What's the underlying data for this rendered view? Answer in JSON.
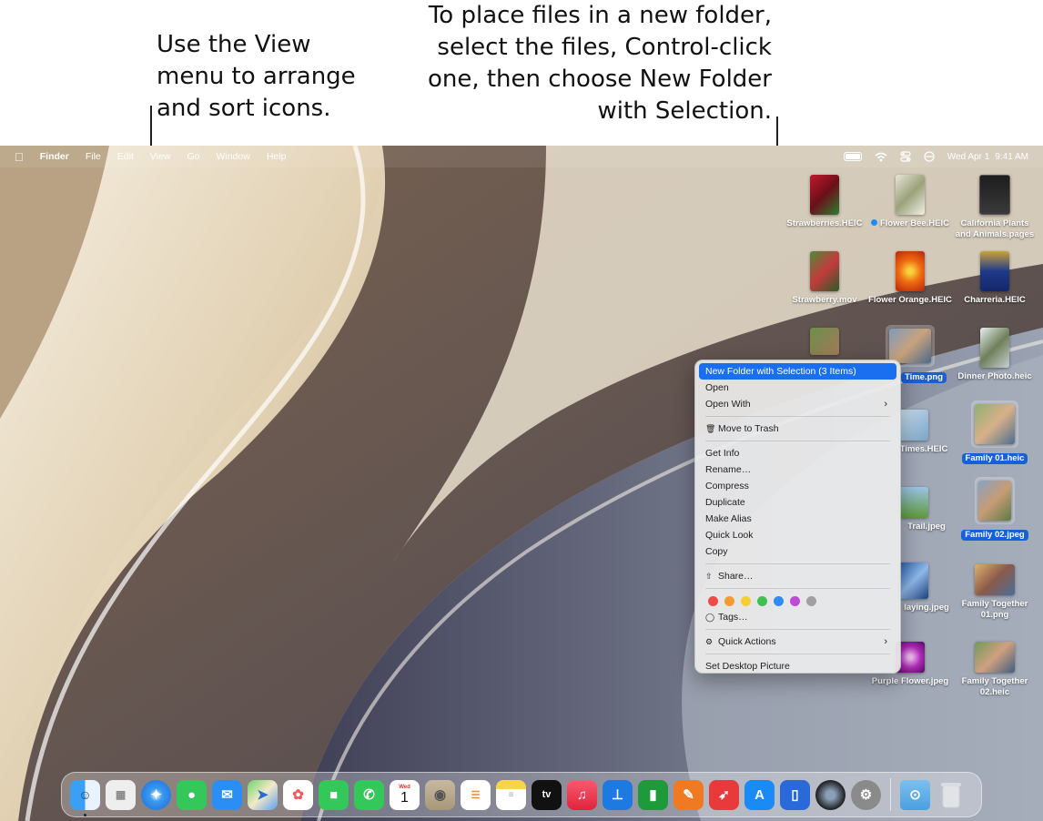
{
  "callouts": {
    "left": "Use the View menu to arrange and sort icons.",
    "right": "To place files in a new folder, select the files, Control-click one, then choose New Folder with Selection."
  },
  "menubar": {
    "apple": "",
    "app_name": "Finder",
    "items": [
      "File",
      "Edit",
      "View",
      "Go",
      "Window",
      "Help"
    ],
    "date": "Wed Apr 1",
    "time": "9:41 AM"
  },
  "desktop_icons": [
    {
      "label": "Strawberries.HEIC",
      "selected": false
    },
    {
      "label": "Flower Bee.HEIC",
      "selected": false,
      "tag": "blue"
    },
    {
      "label": "California Plants and Animals.pages",
      "selected": false
    },
    {
      "label": "Strawberry.mov",
      "selected": false
    },
    {
      "label": "Flower Orange.HEIC",
      "selected": false
    },
    {
      "label": "Charreria.HEIC",
      "selected": false
    },
    {
      "label": "Time.png",
      "selected": true
    },
    {
      "label": "Dinner Photo.heic",
      "selected": false
    },
    {
      "label": "Times.HEIC",
      "selected": false
    },
    {
      "label": "Family 01.heic",
      "selected": true
    },
    {
      "label": "Trail.jpeg",
      "selected": false
    },
    {
      "label": "Family 02.jpeg",
      "selected": true
    },
    {
      "label": "laying.jpeg",
      "selected": false
    },
    {
      "label": "Family Together 01.png",
      "selected": false
    },
    {
      "label": "Purple Flower.jpeg",
      "selected": false
    },
    {
      "label": "Family Together 02.heic",
      "selected": false
    }
  ],
  "context_menu": {
    "new_folder": "New Folder with Selection (3 Items)",
    "open": "Open",
    "open_with": "Open With",
    "move_to_trash": "Move to Trash",
    "get_info": "Get Info",
    "rename": "Rename…",
    "compress": "Compress",
    "duplicate": "Duplicate",
    "make_alias": "Make Alias",
    "quick_look": "Quick Look",
    "copy": "Copy",
    "share": "Share…",
    "tag_colors": [
      "#ef4a4a",
      "#f59a2f",
      "#f3d02f",
      "#3fc052",
      "#2f8cf0",
      "#c04ad8",
      "#a0a0a0"
    ],
    "tags": "Tags…",
    "quick_actions": "Quick Actions",
    "set_desktop_picture": "Set Desktop Picture"
  },
  "dock": {
    "apps": [
      "Finder",
      "Launchpad",
      "Safari",
      "Messages",
      "Mail",
      "Maps",
      "Photos",
      "FaceTime",
      "Phone",
      "Calendar",
      "Contacts",
      "Reminders",
      "Notes",
      "TV",
      "Music",
      "Keynote",
      "Numbers",
      "Pages",
      "Rocket",
      "App Store",
      "Files",
      "Photo Booth",
      "System Settings"
    ],
    "calendar_day": "Wed",
    "calendar_date": "1",
    "tv_label": "tv",
    "extras": [
      "Downloads",
      "Trash"
    ]
  }
}
